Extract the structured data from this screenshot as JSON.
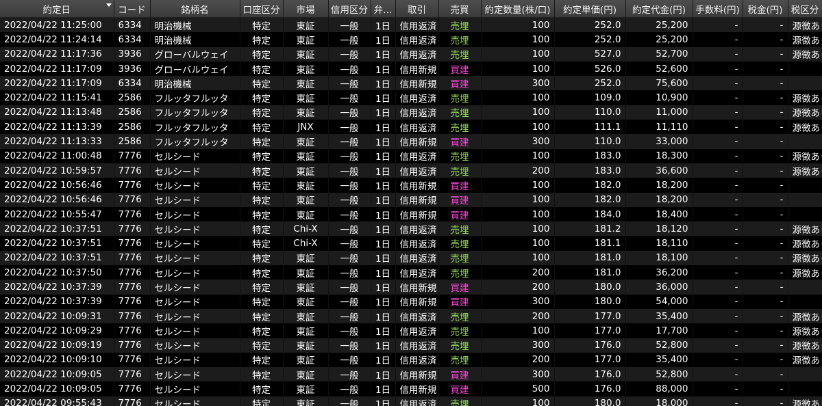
{
  "colors": {
    "sell": "#96e05a",
    "buy": "#ff44dd",
    "header_bg": "#444444",
    "row_odd": "#1c1c1c",
    "row_even": "#000000"
  },
  "columns": [
    "約定日",
    "コード",
    "銘柄名",
    "口座区分",
    "市場",
    "信用区分",
    "弁…",
    "取引",
    "売買",
    "約定数量(株/口)",
    "約定単価(円)",
    "約定代金(円)",
    "手数料(円)",
    "税金(円)",
    "税区分"
  ],
  "sort_column": "約定日",
  "rows": [
    [
      "2022/04/22 11:25:00",
      "6334",
      "明治機械",
      "特定",
      "東証",
      "一般",
      "1日",
      "信用返済",
      "売埋",
      "100",
      "252.0",
      "25,200",
      "-",
      "-",
      "源徴あり"
    ],
    [
      "2022/04/22 11:24:14",
      "6334",
      "明治機械",
      "特定",
      "東証",
      "一般",
      "1日",
      "信用返済",
      "売埋",
      "100",
      "252.0",
      "25,200",
      "-",
      "-",
      "源徴あり"
    ],
    [
      "2022/04/22 11:17:36",
      "3936",
      "グローバルウェイ",
      "特定",
      "東証",
      "一般",
      "1日",
      "信用返済",
      "売埋",
      "100",
      "527.0",
      "52,700",
      "-",
      "-",
      "源徴あり"
    ],
    [
      "2022/04/22 11:17:09",
      "3936",
      "グローバルウェイ",
      "特定",
      "東証",
      "一般",
      "1日",
      "信用新規",
      "買建",
      "100",
      "526.0",
      "52,600",
      "-",
      "-",
      ""
    ],
    [
      "2022/04/22 11:17:09",
      "6334",
      "明治機械",
      "特定",
      "東証",
      "一般",
      "1日",
      "信用新規",
      "買建",
      "300",
      "252.0",
      "75,600",
      "-",
      "-",
      ""
    ],
    [
      "2022/04/22 11:15:41",
      "2586",
      "フルッタフルッタ",
      "特定",
      "東証",
      "一般",
      "1日",
      "信用返済",
      "売埋",
      "100",
      "109.0",
      "10,900",
      "-",
      "-",
      "源徴あり"
    ],
    [
      "2022/04/22 11:13:48",
      "2586",
      "フルッタフルッタ",
      "特定",
      "東証",
      "一般",
      "1日",
      "信用返済",
      "売埋",
      "100",
      "110.0",
      "11,000",
      "-",
      "-",
      "源徴あり"
    ],
    [
      "2022/04/22 11:13:39",
      "2586",
      "フルッタフルッタ",
      "特定",
      "JNX",
      "一般",
      "1日",
      "信用返済",
      "売埋",
      "100",
      "111.1",
      "11,110",
      "-",
      "-",
      "源徴あり"
    ],
    [
      "2022/04/22 11:13:33",
      "2586",
      "フルッタフルッタ",
      "特定",
      "東証",
      "一般",
      "1日",
      "信用新規",
      "買建",
      "300",
      "110.0",
      "33,000",
      "-",
      "-",
      ""
    ],
    [
      "2022/04/22 11:00:48",
      "7776",
      "セルシード",
      "特定",
      "東証",
      "一般",
      "1日",
      "信用返済",
      "売埋",
      "100",
      "183.0",
      "18,300",
      "-",
      "-",
      "源徴あり"
    ],
    [
      "2022/04/22 10:59:57",
      "7776",
      "セルシード",
      "特定",
      "東証",
      "一般",
      "1日",
      "信用返済",
      "売埋",
      "200",
      "183.0",
      "36,600",
      "-",
      "-",
      "源徴あり"
    ],
    [
      "2022/04/22 10:56:46",
      "7776",
      "セルシード",
      "特定",
      "東証",
      "一般",
      "1日",
      "信用新規",
      "買建",
      "100",
      "182.0",
      "18,200",
      "-",
      "-",
      ""
    ],
    [
      "2022/04/22 10:56:46",
      "7776",
      "セルシード",
      "特定",
      "東証",
      "一般",
      "1日",
      "信用新規",
      "買建",
      "100",
      "182.0",
      "18,200",
      "-",
      "-",
      ""
    ],
    [
      "2022/04/22 10:55:47",
      "7776",
      "セルシード",
      "特定",
      "東証",
      "一般",
      "1日",
      "信用新規",
      "買建",
      "100",
      "184.0",
      "18,400",
      "-",
      "-",
      ""
    ],
    [
      "2022/04/22 10:37:51",
      "7776",
      "セルシード",
      "特定",
      "Chi-X",
      "一般",
      "1日",
      "信用返済",
      "売埋",
      "100",
      "181.2",
      "18,120",
      "-",
      "-",
      "源徴あり"
    ],
    [
      "2022/04/22 10:37:51",
      "7776",
      "セルシード",
      "特定",
      "Chi-X",
      "一般",
      "1日",
      "信用返済",
      "売埋",
      "100",
      "181.1",
      "18,110",
      "-",
      "-",
      "源徴あり"
    ],
    [
      "2022/04/22 10:37:51",
      "7776",
      "セルシード",
      "特定",
      "東証",
      "一般",
      "1日",
      "信用返済",
      "売埋",
      "100",
      "181.0",
      "18,100",
      "-",
      "-",
      "源徴あり"
    ],
    [
      "2022/04/22 10:37:50",
      "7776",
      "セルシード",
      "特定",
      "東証",
      "一般",
      "1日",
      "信用返済",
      "売埋",
      "200",
      "181.0",
      "36,200",
      "-",
      "-",
      "源徴あり"
    ],
    [
      "2022/04/22 10:37:39",
      "7776",
      "セルシード",
      "特定",
      "東証",
      "一般",
      "1日",
      "信用新規",
      "買建",
      "200",
      "180.0",
      "36,000",
      "-",
      "-",
      ""
    ],
    [
      "2022/04/22 10:37:39",
      "7776",
      "セルシード",
      "特定",
      "東証",
      "一般",
      "1日",
      "信用新規",
      "買建",
      "300",
      "180.0",
      "54,000",
      "-",
      "-",
      ""
    ],
    [
      "2022/04/22 10:09:31",
      "7776",
      "セルシード",
      "特定",
      "東証",
      "一般",
      "1日",
      "信用返済",
      "売埋",
      "200",
      "177.0",
      "35,400",
      "-",
      "-",
      "源徴あり"
    ],
    [
      "2022/04/22 10:09:29",
      "7776",
      "セルシード",
      "特定",
      "東証",
      "一般",
      "1日",
      "信用返済",
      "売埋",
      "100",
      "177.0",
      "17,700",
      "-",
      "-",
      "源徴あり"
    ],
    [
      "2022/04/22 10:09:19",
      "7776",
      "セルシード",
      "特定",
      "東証",
      "一般",
      "1日",
      "信用返済",
      "売埋",
      "300",
      "176.0",
      "52,800",
      "-",
      "-",
      "源徴あり"
    ],
    [
      "2022/04/22 10:09:10",
      "7776",
      "セルシード",
      "特定",
      "東証",
      "一般",
      "1日",
      "信用返済",
      "売埋",
      "200",
      "177.0",
      "35,400",
      "-",
      "-",
      "源徴あり"
    ],
    [
      "2022/04/22 10:09:05",
      "7776",
      "セルシード",
      "特定",
      "東証",
      "一般",
      "1日",
      "信用新規",
      "買建",
      "300",
      "176.0",
      "52,800",
      "-",
      "-",
      ""
    ],
    [
      "2022/04/22 10:09:05",
      "7776",
      "セルシード",
      "特定",
      "東証",
      "一般",
      "1日",
      "信用新規",
      "買建",
      "500",
      "176.0",
      "88,000",
      "-",
      "-",
      ""
    ],
    [
      "2022/04/22 09:55:43",
      "7776",
      "セルシード",
      "特定",
      "東証",
      "一般",
      "1日",
      "信用返済",
      "売埋",
      "100",
      "180.0",
      "18,000",
      "-",
      "-",
      "源徴あり"
    ]
  ]
}
